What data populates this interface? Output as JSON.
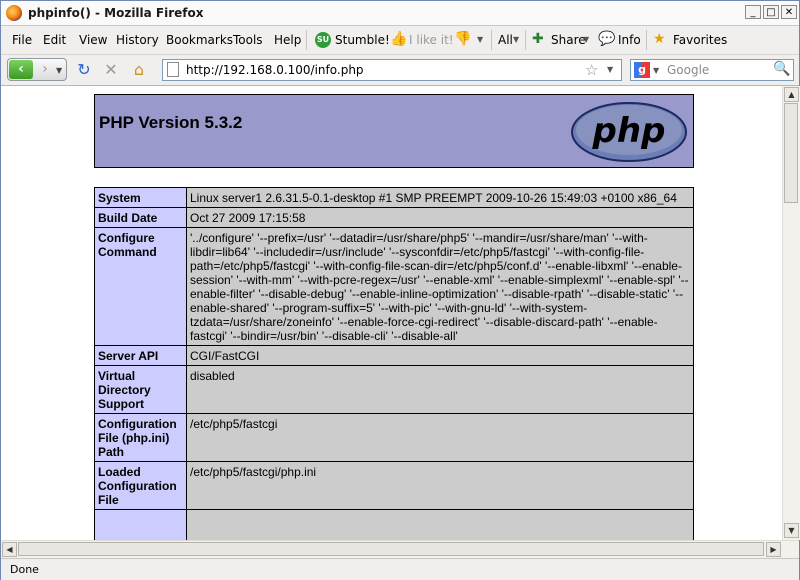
{
  "window": {
    "title": "phpinfo() - Mozilla Firefox"
  },
  "menubar": {
    "items": [
      "File",
      "Edit",
      "View",
      "History",
      "Bookmarks",
      "Tools",
      "Help"
    ],
    "stumble_label": "Stumble!",
    "like_label": "I like it!",
    "all_label": "All",
    "share_label": "Share",
    "info_label": "Info",
    "favorites_label": "Favorites"
  },
  "navbar": {
    "url": "http://192.168.0.100/info.php",
    "search_placeholder": "Google"
  },
  "page": {
    "php_version_title": "PHP Version 5.3.2",
    "logo_text": "php",
    "rows": [
      {
        "key": "System",
        "value": "Linux server1 2.6.31.5-0.1-desktop #1 SMP PREEMPT 2009-10-26 15:49:03 +0100 x86_64"
      },
      {
        "key": "Build Date",
        "value": "Oct 27 2009 17:15:58"
      },
      {
        "key": "Configure Command",
        "value": "'../configure' '--prefix=/usr' '--datadir=/usr/share/php5' '--mandir=/usr/share/man' '--with-libdir=lib64' '--includedir=/usr/include' '--sysconfdir=/etc/php5/fastcgi' '--with-config-file-path=/etc/php5/fastcgi' '--with-config-file-scan-dir=/etc/php5/conf.d' '--enable-libxml' '--enable-session' '--with-mm' '--with-pcre-regex=/usr' '--enable-xml' '--enable-simplexml' '--enable-spl' '--enable-filter' '--disable-debug' '--enable-inline-optimization' '--disable-rpath' '--disable-static' '--enable-shared' '--program-suffix=5' '--with-pic' '--with-gnu-ld' '--with-system-tzdata=/usr/share/zoneinfo' '--enable-force-cgi-redirect' '--disable-discard-path' '--enable-fastcgi' '--bindir=/usr/bin' '--disable-cli' '--disable-all'"
      },
      {
        "key": "Server API",
        "value": "CGI/FastCGI"
      },
      {
        "key": "Virtual Directory Support",
        "value": "disabled"
      },
      {
        "key": "Configuration File (php.ini) Path",
        "value": "/etc/php5/fastcgi"
      },
      {
        "key": "Loaded Configuration File",
        "value": "/etc/php5/fastcgi/php.ini"
      },
      {
        "key": "",
        "value": ""
      }
    ]
  },
  "statusbar": {
    "status_text": "Done"
  },
  "colors": {
    "php_header_bg": "#9999cc",
    "key_cell_bg": "#ccccff",
    "value_cell_bg": "#cccccc"
  }
}
